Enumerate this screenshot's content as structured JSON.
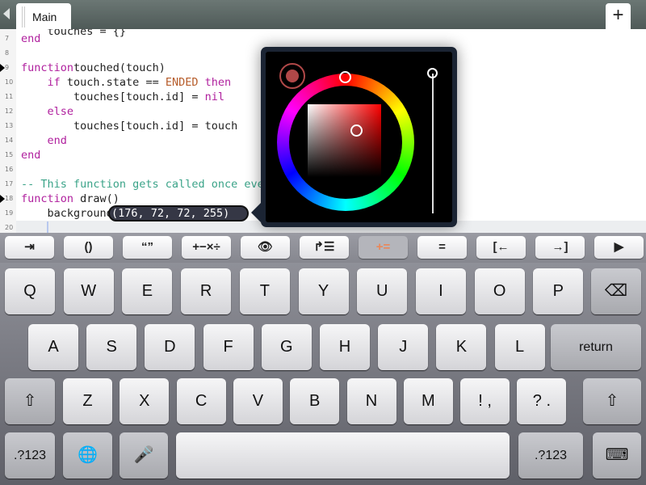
{
  "tab": {
    "label": "Main",
    "add": "+"
  },
  "code": [
    {
      "n": "7",
      "parts": [
        [
          "kw",
          "end"
        ]
      ]
    },
    {
      "n": "8",
      "parts": []
    },
    {
      "n": "9",
      "mark": true,
      "parts": [
        [
          "kw",
          "function"
        ],
        [
          "",
          "touched(touch)"
        ]
      ]
    },
    {
      "n": "10",
      "parts": [
        [
          "",
          "    "
        ],
        [
          "kw",
          "if"
        ],
        [
          "",
          " touch.state == "
        ],
        [
          "const",
          "ENDED"
        ],
        [
          "kw",
          " then"
        ]
      ]
    },
    {
      "n": "11",
      "parts": [
        [
          "",
          "        touches[touch.id] = "
        ],
        [
          "kw",
          "nil"
        ]
      ]
    },
    {
      "n": "12",
      "parts": [
        [
          "kw",
          "    else"
        ]
      ]
    },
    {
      "n": "13",
      "parts": [
        [
          "",
          "        touches[touch.id] = touch"
        ]
      ]
    },
    {
      "n": "14",
      "parts": [
        [
          "kw",
          "    end"
        ]
      ]
    },
    {
      "n": "15",
      "parts": [
        [
          "kw",
          "end"
        ]
      ]
    },
    {
      "n": "16",
      "parts": []
    },
    {
      "n": "17",
      "parts": [
        [
          "cm",
          "-- This function gets called once every frame"
        ]
      ]
    },
    {
      "n": "18",
      "mark": true,
      "parts": [
        [
          "kw",
          "function"
        ],
        [
          "",
          " draw()"
        ]
      ]
    },
    {
      "n": "19",
      "parts": [
        [
          "",
          "    background"
        ]
      ]
    },
    {
      "n": "20",
      "parts": []
    }
  ],
  "color_value": "(176, 72, 72, 255)",
  "picker": {
    "color": "#b04848",
    "rgba": [
      176,
      72,
      72,
      255
    ],
    "alpha": 1.0
  },
  "toolbar": [
    {
      "name": "tab",
      "glyph": "⇥"
    },
    {
      "name": "parentheses",
      "glyph": "()"
    },
    {
      "name": "quotes",
      "glyph": "“”"
    },
    {
      "name": "operators",
      "glyph": "+−×÷"
    },
    {
      "name": "eye",
      "glyph": "👁"
    },
    {
      "name": "indent-list",
      "glyph": "↱☰"
    },
    {
      "name": "plus-equals",
      "glyph": "+=",
      "disabled": true
    },
    {
      "name": "equals",
      "glyph": "="
    },
    {
      "name": "cursor-left",
      "glyph": "[←"
    },
    {
      "name": "cursor-right",
      "glyph": "→]"
    },
    {
      "name": "run",
      "glyph": "▶"
    }
  ],
  "keys": {
    "row1": [
      "Q",
      "W",
      "E",
      "R",
      "T",
      "Y",
      "U",
      "I",
      "O",
      "P"
    ],
    "row2": [
      "A",
      "S",
      "D",
      "F",
      "G",
      "H",
      "J",
      "K",
      "L"
    ],
    "row3": [
      "Z",
      "X",
      "C",
      "V",
      "B",
      "N",
      "M",
      "! ,",
      "? ."
    ],
    "return": "return",
    "numbers": ".?123",
    "backspace": "⌫",
    "shift": "⇧",
    "globe": "🌐",
    "mic": "🎤",
    "hide": "⌨"
  }
}
